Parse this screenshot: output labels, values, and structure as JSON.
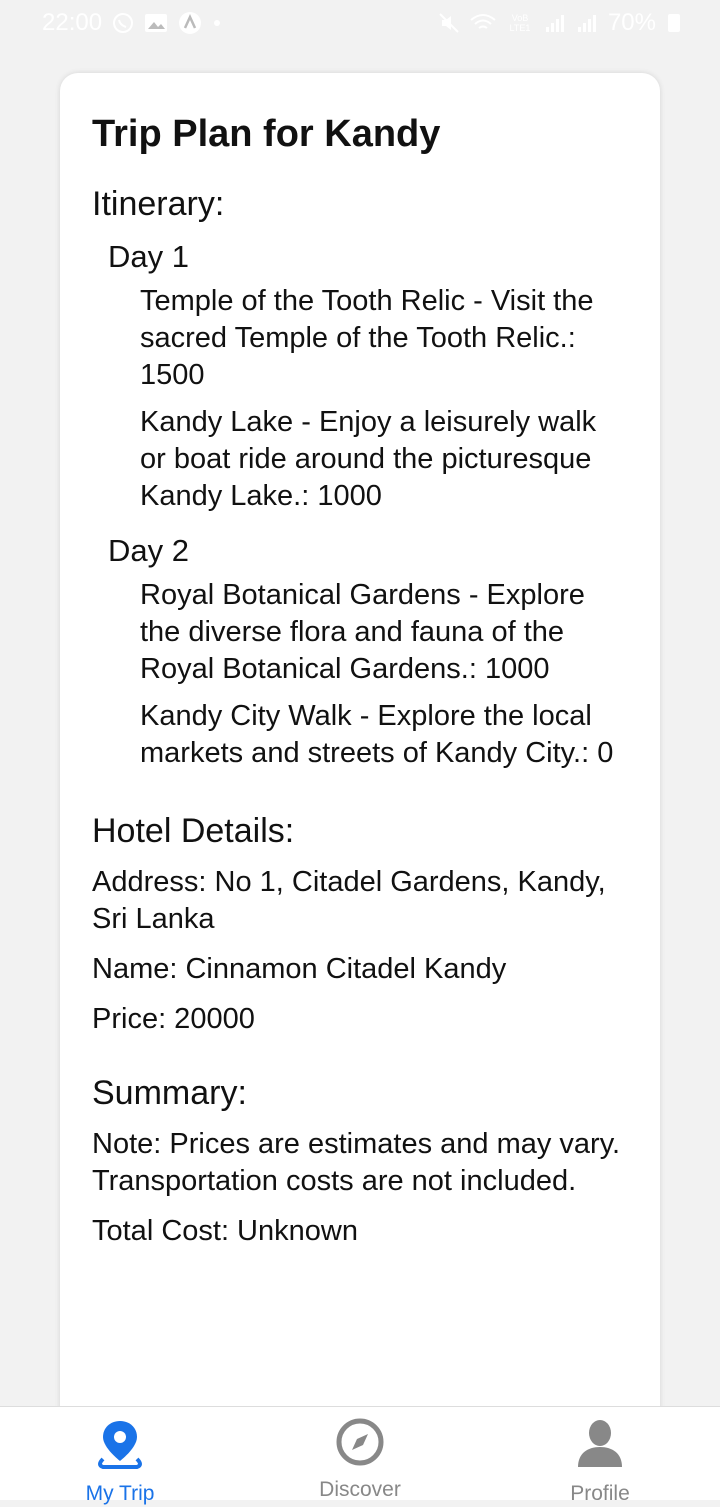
{
  "status_bar": {
    "time": "22:00",
    "battery": "70%",
    "network": "VoB LTE1"
  },
  "trip": {
    "title": "Trip Plan for Kandy",
    "itinerary_heading": "Itinerary:",
    "days": [
      {
        "label": "Day 1",
        "activities": [
          "Temple of the Tooth Relic - Visit the sacred Temple of the Tooth Relic.: 1500",
          "Kandy Lake - Enjoy a leisurely walk or boat ride around the picturesque Kandy Lake.: 1000"
        ]
      },
      {
        "label": "Day 2",
        "activities": [
          "Royal Botanical Gardens - Explore the diverse flora and fauna of the Royal Botanical Gardens.: 1000",
          "Kandy City Walk - Explore the local markets and streets of Kandy City.: 0"
        ]
      }
    ],
    "hotel": {
      "heading": "Hotel Details:",
      "address": "Address: No 1, Citadel Gardens, Kandy, Sri Lanka",
      "name": "Name: Cinnamon Citadel Kandy",
      "price": "Price: 20000"
    },
    "summary": {
      "heading": "Summary:",
      "note": "Note: Prices are estimates and may vary. Transportation costs are not included.",
      "total": "Total Cost: Unknown"
    }
  },
  "bottom_nav": {
    "items": [
      {
        "label": "My Trip",
        "icon": "map-pin-icon",
        "active": true
      },
      {
        "label": "Discover",
        "icon": "compass-icon",
        "active": false
      },
      {
        "label": "Profile",
        "icon": "person-icon",
        "active": false
      }
    ],
    "active_color": "#1a73e8",
    "inactive_color": "#888888"
  }
}
